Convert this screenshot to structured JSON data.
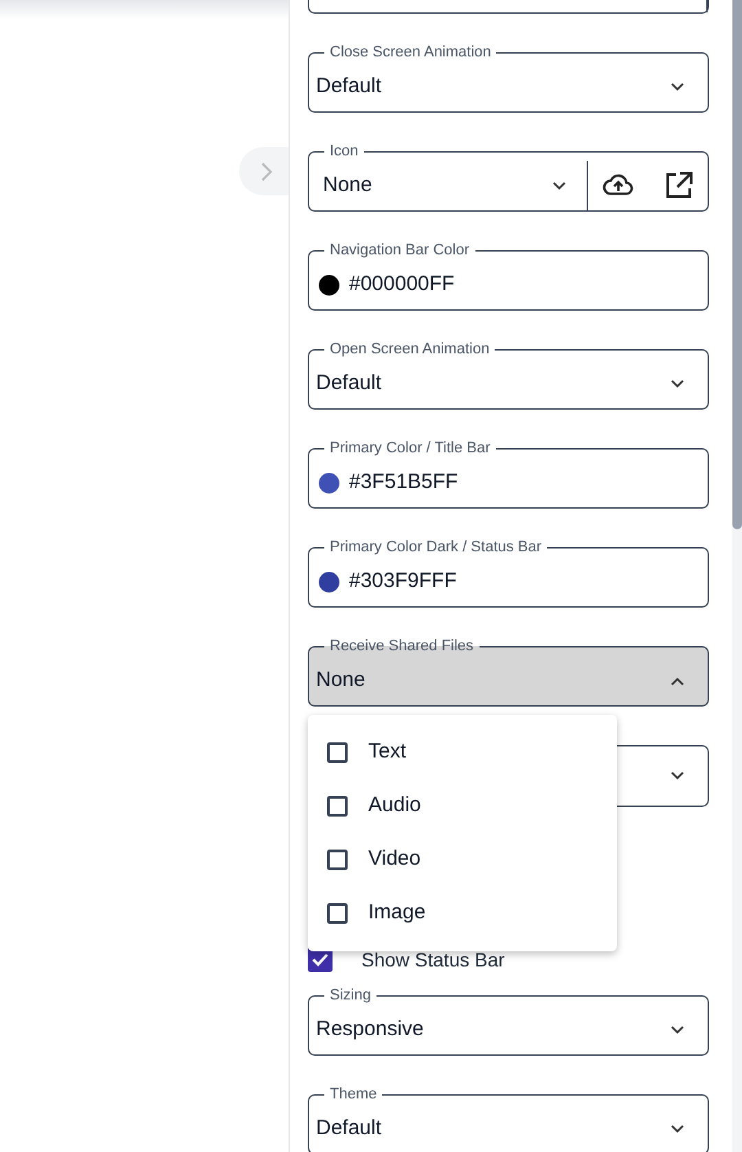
{
  "fields": [
    {
      "kind": "blank_split"
    },
    {
      "kind": "select",
      "label": "Close Screen Animation",
      "value": "Default",
      "open": false
    },
    {
      "kind": "select_buttons",
      "label": "Icon",
      "value": "None",
      "open": false
    },
    {
      "kind": "color",
      "label": "Navigation Bar Color",
      "value": "#000000FF",
      "color": "#000000"
    },
    {
      "kind": "select",
      "label": "Open Screen Animation",
      "value": "Default",
      "open": false
    },
    {
      "kind": "color",
      "label": "Primary Color / Title Bar",
      "value": "#3F51B5FF",
      "color": "#3f51b5"
    },
    {
      "kind": "color",
      "label": "Primary Color Dark / Status Bar",
      "value": "#303F9FFF",
      "color": "#303f9f"
    },
    {
      "kind": "select",
      "label": "Receive Shared Files",
      "value": "None",
      "open": true
    },
    {
      "kind": "blank_select"
    },
    {
      "kind": "checkbox",
      "label": "Show Status Bar",
      "checked": true
    },
    {
      "kind": "select",
      "label": "Sizing",
      "value": "Responsive",
      "open": false
    },
    {
      "kind": "select",
      "label": "Theme",
      "value": "Default",
      "open": false
    }
  ],
  "menu": [
    {
      "label": "Text",
      "checked": false
    },
    {
      "label": "Audio",
      "checked": false
    },
    {
      "label": "Video",
      "checked": false
    },
    {
      "label": "Image",
      "checked": false
    }
  ]
}
